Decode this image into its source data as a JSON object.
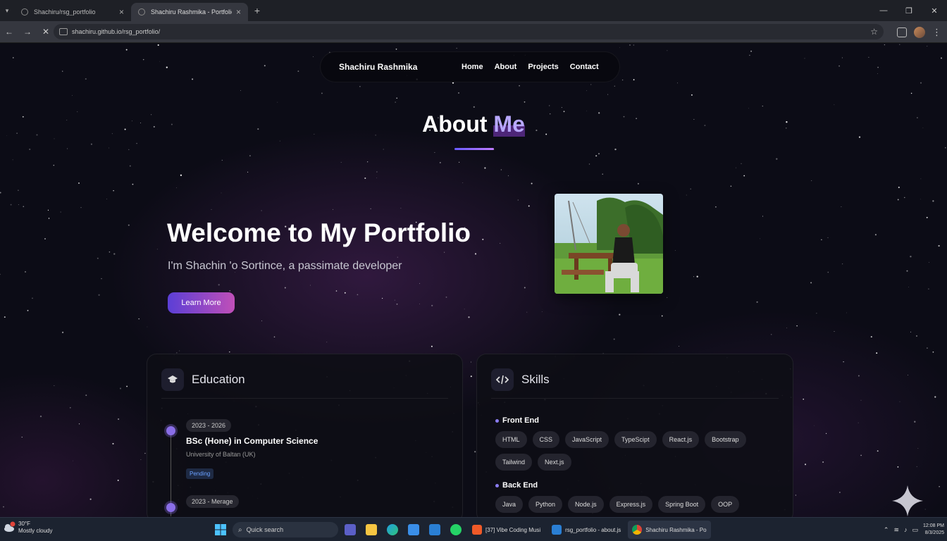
{
  "browser": {
    "tabs": [
      {
        "title": "Shachiru/rsg_portfolio",
        "active": false
      },
      {
        "title": "Shachiru Rashmika - Portfolio",
        "active": true
      }
    ],
    "url": "shachiru.github.io/rsg_portfolio/"
  },
  "site": {
    "brand": "Shachiru Rashmika",
    "nav": [
      "Home",
      "About",
      "Projects",
      "Contact"
    ]
  },
  "about": {
    "title_main": "About",
    "title_accent": "Me"
  },
  "hero": {
    "heading": "Welcome to My Portfolio",
    "intro": "I'm Shachin 'o Sortince, a passimate developer",
    "button": "Learn More"
  },
  "education": {
    "title": "Education",
    "items": [
      {
        "dates": "2023 - 2026",
        "degree": "BSc (Hone) in Computer Science",
        "school": "University of Baltan (UK)",
        "status": "Pending"
      },
      {
        "dates": "2023 - Merage"
      }
    ]
  },
  "skills": {
    "title": "Skills",
    "categories": [
      {
        "name": "Front End",
        "items": [
          "HTML",
          "CSS",
          "JavaScript",
          "TypeScipt",
          "React.js",
          "Bootstrap",
          "Tailwind",
          "Next.js"
        ]
      },
      {
        "name": "Back End",
        "items": [
          "Java",
          "Python",
          "Node.js",
          "Express.js",
          "Spring Boot",
          "OOP"
        ]
      }
    ]
  },
  "taskbar": {
    "weather_temp": "30°F",
    "weather_desc": "Mostly cloudy",
    "search_placeholder": "Quick search",
    "apps": [
      {
        "label": "[37] Vibe Coding Musi"
      },
      {
        "label": "rsg_portfolio - about.js"
      },
      {
        "label": "Shachiru Rashmika - Po"
      }
    ],
    "time": "12:08 PM",
    "date": "8/3/2025"
  },
  "colors": {
    "accent_purple": "#8a6ee8",
    "button_start": "#5b3fd6",
    "button_end": "#c04fb8"
  }
}
